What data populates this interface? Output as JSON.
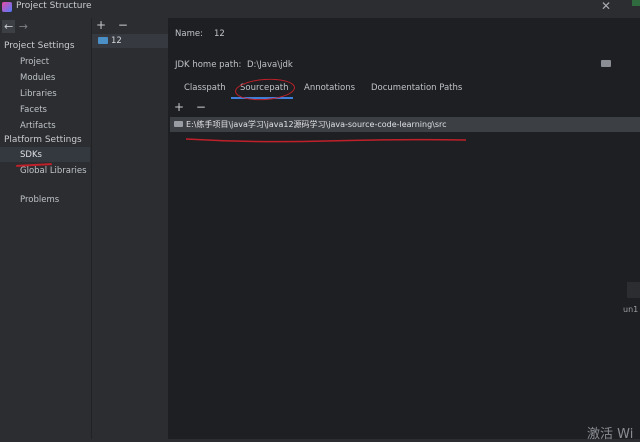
{
  "window": {
    "title": "Project Structure"
  },
  "left_panel": {
    "project_settings": "Project Settings",
    "project_items": [
      "Project",
      "Modules",
      "Libraries",
      "Facets",
      "Artifacts"
    ],
    "platform_settings": "Platform Settings",
    "platform_items": [
      "SDKs",
      "Global Libraries"
    ],
    "problems": "Problems"
  },
  "sdk_list": {
    "add": "+",
    "remove": "−",
    "items": [
      "12"
    ]
  },
  "detail": {
    "name_label": "Name:",
    "name_value": "12",
    "home_label": "JDK home path:",
    "home_value": "D:\\Java\\jdk",
    "tabs": [
      "Classpath",
      "Sourcepath",
      "Annotations",
      "Documentation Paths"
    ],
    "active_tab": "Sourcepath",
    "list_add": "+",
    "list_remove": "−",
    "paths": [
      "E:\\练手项目\\java学习\\java12源码学习\\java-source-code-learning\\src"
    ]
  },
  "edge_text": "un1",
  "watermark": "激活 Wi",
  "colors": {
    "annotation": "#c0202a",
    "active_tab": "#3f7fd9",
    "selection": "#3c3f44"
  },
  "icons": {
    "close": "close-icon",
    "back": "back-arrow-icon",
    "forward": "forward-arrow-icon",
    "folder": "folder-icon",
    "sdk": "sdk-icon"
  }
}
